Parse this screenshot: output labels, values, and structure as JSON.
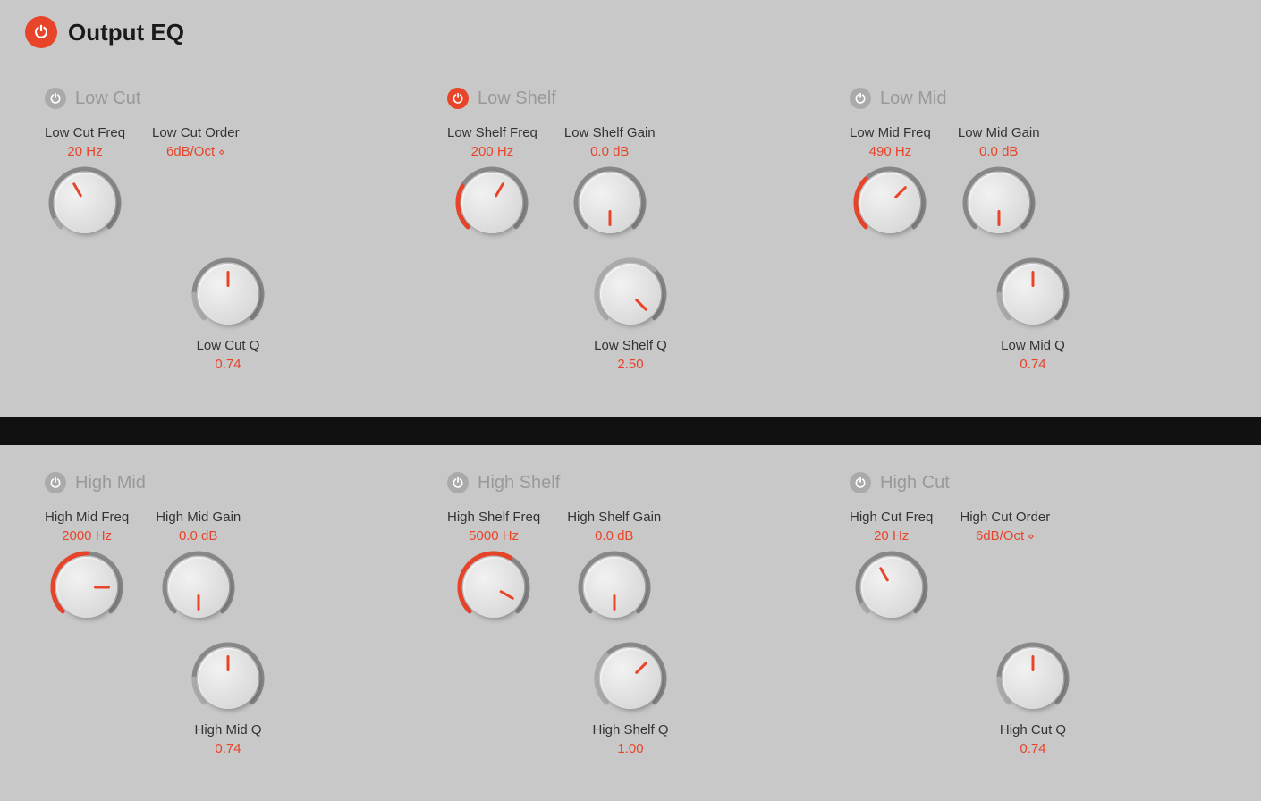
{
  "header": {
    "title": "Output EQ",
    "power_active": true
  },
  "top_row": [
    {
      "id": "low-cut",
      "title": "Low Cut",
      "active": false,
      "knobs": [
        {
          "id": "low-cut-freq",
          "label": "Low Cut Freq",
          "value": "20 Hz",
          "type": "knob",
          "arc_start": -135,
          "arc_end": -120,
          "size": "large",
          "arc_color": "#aaa"
        },
        {
          "id": "low-cut-order",
          "label": "Low Cut Order",
          "value": "6dB/Oct",
          "type": "dropdown",
          "size": "none"
        }
      ],
      "bottom_knob": {
        "id": "low-cut-q",
        "label": "Low Cut Q",
        "value": "0.74",
        "arc_start": -135,
        "arc_end": -90,
        "size": "large",
        "arc_color": "#aaa"
      }
    },
    {
      "id": "low-shelf",
      "title": "Low Shelf",
      "active": true,
      "knobs": [
        {
          "id": "low-shelf-freq",
          "label": "Low Shelf Freq",
          "value": "200 Hz",
          "type": "knob",
          "arc_start": -135,
          "arc_end": -60,
          "size": "large",
          "arc_color": "#e8442a"
        },
        {
          "id": "low-shelf-gain",
          "label": "Low Shelf Gain",
          "value": "0.0 dB",
          "type": "knob",
          "arc_start": 90,
          "arc_end": 90,
          "size": "large",
          "arc_color": "#aaa"
        }
      ],
      "bottom_knob": {
        "id": "low-shelf-q",
        "label": "Low Shelf Q",
        "value": "2.50",
        "arc_start": -135,
        "arc_end": 45,
        "size": "large",
        "arc_color": "#aaa"
      }
    },
    {
      "id": "low-mid",
      "title": "Low Mid",
      "active": false,
      "knobs": [
        {
          "id": "low-mid-freq",
          "label": "Low Mid Freq",
          "value": "490 Hz",
          "type": "knob",
          "arc_start": -135,
          "arc_end": -45,
          "size": "large",
          "arc_color": "#e8442a"
        },
        {
          "id": "low-mid-gain",
          "label": "Low Mid Gain",
          "value": "0.0 dB",
          "type": "knob",
          "arc_start": 90,
          "arc_end": 90,
          "size": "large",
          "arc_color": "#aaa"
        }
      ],
      "bottom_knob": {
        "id": "low-mid-q",
        "label": "Low Mid Q",
        "value": "0.74",
        "arc_start": -135,
        "arc_end": -90,
        "size": "large",
        "arc_color": "#aaa"
      }
    }
  ],
  "bottom_row": [
    {
      "id": "high-mid",
      "title": "High Mid",
      "active": false,
      "knobs": [
        {
          "id": "high-mid-freq",
          "label": "High Mid Freq",
          "value": "2000 Hz",
          "type": "knob",
          "arc_start": -135,
          "arc_end": 0,
          "size": "large",
          "arc_color": "#e8442a"
        },
        {
          "id": "high-mid-gain",
          "label": "High Mid Gain",
          "value": "0.0 dB",
          "type": "knob",
          "arc_start": 90,
          "arc_end": 90,
          "size": "large",
          "arc_color": "#aaa"
        }
      ],
      "bottom_knob": {
        "id": "high-mid-q",
        "label": "High Mid Q",
        "value": "0.74",
        "arc_start": -135,
        "arc_end": -90,
        "size": "large",
        "arc_color": "#aaa"
      }
    },
    {
      "id": "high-shelf",
      "title": "High Shelf",
      "active": false,
      "knobs": [
        {
          "id": "high-shelf-freq",
          "label": "High Shelf Freq",
          "value": "5000 Hz",
          "type": "knob",
          "arc_start": -135,
          "arc_end": 30,
          "size": "large",
          "arc_color": "#e8442a"
        },
        {
          "id": "high-shelf-gain",
          "label": "High Shelf Gain",
          "value": "0.0 dB",
          "type": "knob",
          "arc_start": 90,
          "arc_end": 90,
          "size": "large",
          "arc_color": "#aaa"
        }
      ],
      "bottom_knob": {
        "id": "high-shelf-q",
        "label": "High Shelf Q",
        "value": "1.00",
        "arc_start": -135,
        "arc_end": -45,
        "size": "large",
        "arc_color": "#aaa"
      }
    },
    {
      "id": "high-cut",
      "title": "High Cut",
      "active": false,
      "knobs": [
        {
          "id": "high-cut-freq",
          "label": "High Cut Freq",
          "value": "20 Hz",
          "type": "knob",
          "arc_start": -135,
          "arc_end": -120,
          "size": "large",
          "arc_color": "#aaa"
        },
        {
          "id": "high-cut-order",
          "label": "High Cut Order",
          "value": "6dB/Oct",
          "type": "dropdown",
          "size": "none"
        }
      ],
      "bottom_knob": {
        "id": "high-cut-q",
        "label": "High Cut Q",
        "value": "0.74",
        "arc_start": -135,
        "arc_end": -90,
        "size": "large",
        "arc_color": "#aaa"
      }
    }
  ]
}
